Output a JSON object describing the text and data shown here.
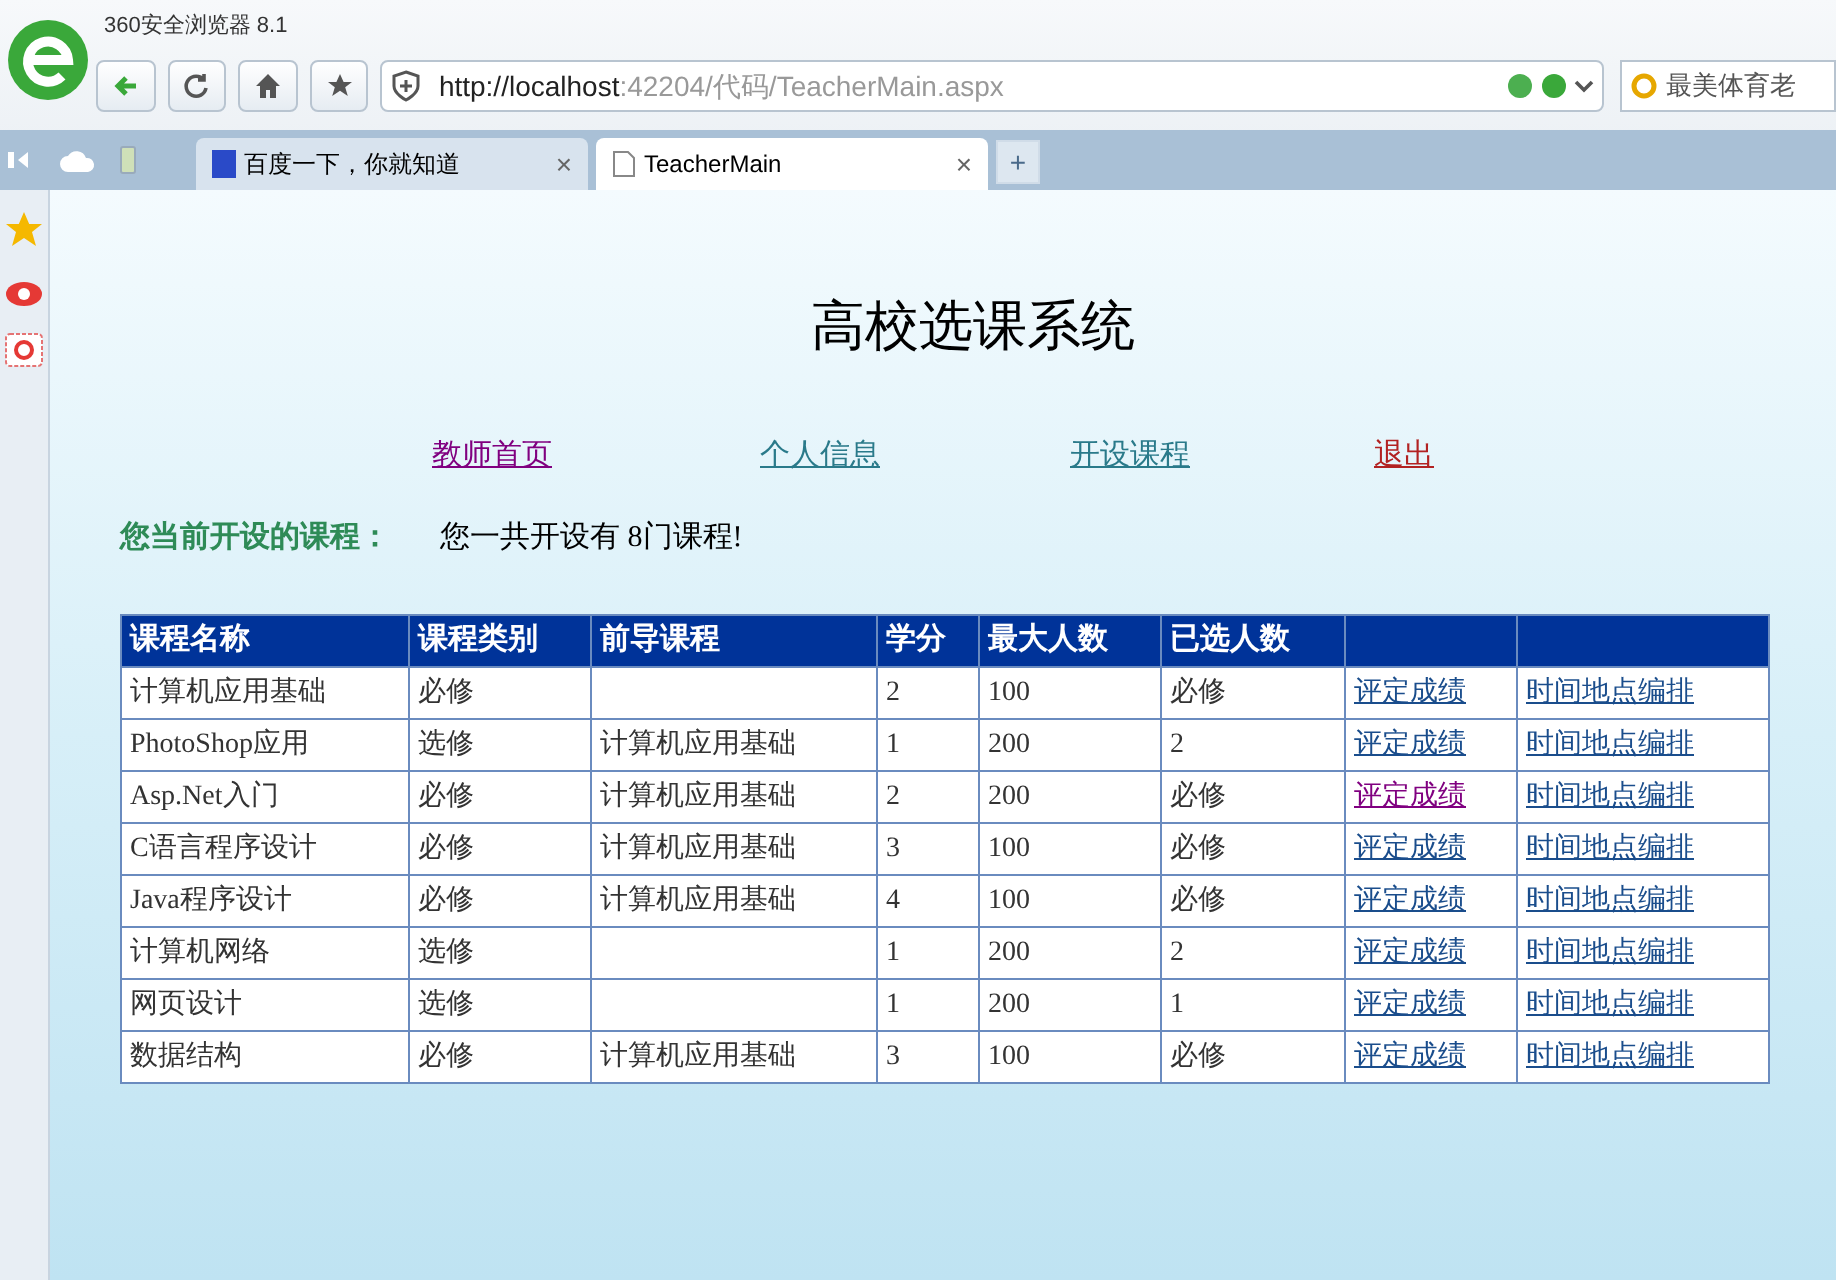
{
  "browser": {
    "title": "360安全浏览器 8.1",
    "url_host": "http://localhost",
    "url_path": ":42204/代码/TeacherMain.aspx",
    "search_placeholder": "最美体育老"
  },
  "tabs": [
    {
      "label": "百度一下，你就知道",
      "selected": false,
      "close": "×"
    },
    {
      "label": "TeacherMain",
      "selected": true,
      "close": "×"
    }
  ],
  "new_tab": "+",
  "page": {
    "title": "高校选课系统",
    "nav": [
      {
        "label": "教师首页",
        "color": "#800080"
      },
      {
        "label": "个人信息",
        "color": "#2a7a8a"
      },
      {
        "label": "开设课程",
        "color": "#2a7a8a"
      },
      {
        "label": "退出",
        "color": "#b22222"
      }
    ],
    "summary_label": "您当前开设的课程：",
    "summary_text": "您一共开设有 8门课程!"
  },
  "table": {
    "columns": [
      "课程名称",
      "课程类别",
      "前导课程",
      "学分",
      "最大人数",
      "已选人数"
    ],
    "rows": [
      {
        "cells": [
          "计算机应用基础",
          "必修",
          "",
          "2",
          "100",
          "必修"
        ],
        "grade_link": "评定成绩",
        "grade_visited": false,
        "schedule_link": "时间地点编排"
      },
      {
        "cells": [
          "PhotoShop应用",
          "选修",
          "计算机应用基础",
          "1",
          "200",
          "2"
        ],
        "grade_link": "评定成绩",
        "grade_visited": false,
        "schedule_link": "时间地点编排"
      },
      {
        "cells": [
          "Asp.Net入门",
          "必修",
          "计算机应用基础",
          "2",
          "200",
          "必修"
        ],
        "grade_link": "评定成绩",
        "grade_visited": true,
        "schedule_link": "时间地点编排"
      },
      {
        "cells": [
          "C语言程序设计",
          "必修",
          "计算机应用基础",
          "3",
          "100",
          "必修"
        ],
        "grade_link": "评定成绩",
        "grade_visited": false,
        "schedule_link": "时间地点编排"
      },
      {
        "cells": [
          "Java程序设计",
          "必修",
          "计算机应用基础",
          "4",
          "100",
          "必修"
        ],
        "grade_link": "评定成绩",
        "grade_visited": false,
        "schedule_link": "时间地点编排"
      },
      {
        "cells": [
          "计算机网络",
          "选修",
          "",
          "1",
          "200",
          "2"
        ],
        "grade_link": "评定成绩",
        "grade_visited": false,
        "schedule_link": "时间地点编排"
      },
      {
        "cells": [
          "网页设计",
          "选修",
          "",
          "1",
          "200",
          "1"
        ],
        "grade_link": "评定成绩",
        "grade_visited": false,
        "schedule_link": "时间地点编排"
      },
      {
        "cells": [
          "数据结构",
          "必修",
          "计算机应用基础",
          "3",
          "100",
          "必修"
        ],
        "grade_link": "评定成绩",
        "grade_visited": false,
        "schedule_link": "时间地点编排"
      }
    ]
  }
}
